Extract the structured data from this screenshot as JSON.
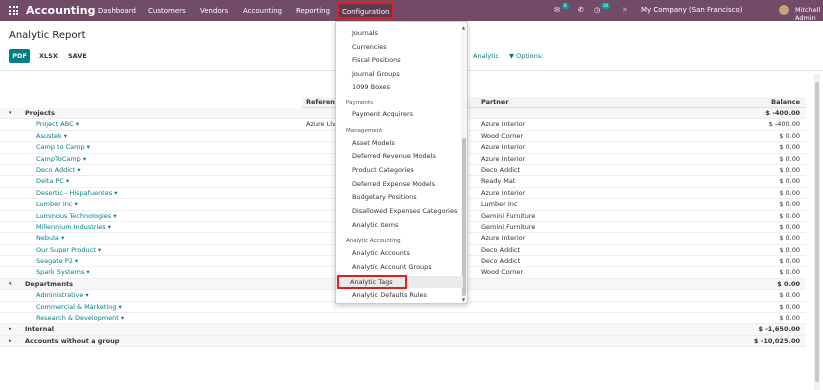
{
  "nav": {
    "brand": "Accounting",
    "items": [
      "Dashboard",
      "Customers",
      "Vendors",
      "Accounting",
      "Reporting",
      "Configuration"
    ],
    "chat_count": "8",
    "activity_count": "34",
    "company": "My Company (San Francisco)",
    "user": "Mitchell Admin"
  },
  "page": {
    "title": "Analytic Report",
    "buttons": [
      "PDF",
      "XLSX",
      "SAVE"
    ],
    "filters": {
      "analytic": "Analytic",
      "options": "Options:"
    }
  },
  "table": {
    "headers": {
      "reference": "Reference",
      "partner": "Partner",
      "balance": "Balance"
    },
    "rows": [
      {
        "name": "Projects",
        "ref": "",
        "partner": "",
        "balance": "$ -400.00",
        "group": true,
        "caret": "▾"
      },
      {
        "name": "Project ABC ▾",
        "ref": "Azure Liv",
        "partner": "Azure Interior",
        "balance": "$ -400.00"
      },
      {
        "name": "Asustek ▾",
        "ref": "",
        "partner": "Wood Corner",
        "balance": "$ 0.00"
      },
      {
        "name": "Camp to Camp ▾",
        "ref": "",
        "partner": "Azure Interior",
        "balance": "$ 0.00"
      },
      {
        "name": "CampToCamp ▾",
        "ref": "",
        "partner": "Azure Interior",
        "balance": "$ 0.00"
      },
      {
        "name": "Deco Addict ▾",
        "ref": "",
        "partner": "Deco Addict",
        "balance": "$ 0.00"
      },
      {
        "name": "Delta PC ▾",
        "ref": "",
        "partner": "Ready Mat",
        "balance": "$ 0.00"
      },
      {
        "name": "Desertic - Hispafuentes ▾",
        "ref": "",
        "partner": "Azure Interior",
        "balance": "$ 0.00"
      },
      {
        "name": "Lumber Inc ▾",
        "ref": "",
        "partner": "Lumber Inc",
        "balance": "$ 0.00"
      },
      {
        "name": "Luminous Technologies ▾",
        "ref": "",
        "partner": "Gemini Furniture",
        "balance": "$ 0.00"
      },
      {
        "name": "Millennium Industries ▾",
        "ref": "",
        "partner": "Gemini Furniture",
        "balance": "$ 0.00"
      },
      {
        "name": "Nebula ▾",
        "ref": "",
        "partner": "Azure Interior",
        "balance": "$ 0.00"
      },
      {
        "name": "Our Super Product ▾",
        "ref": "",
        "partner": "Deco Addict",
        "balance": "$ 0.00"
      },
      {
        "name": "Seagate P2 ▾",
        "ref": "",
        "partner": "Deco Addict",
        "balance": "$ 0.00"
      },
      {
        "name": "Spark Systems ▾",
        "ref": "",
        "partner": "Wood Corner",
        "balance": "$ 0.00"
      },
      {
        "name": "Departments",
        "ref": "",
        "partner": "",
        "balance": "$ 0.00",
        "group": true,
        "caret": "▾"
      },
      {
        "name": "Administrative ▾",
        "ref": "",
        "partner": "",
        "balance": "$ 0.00"
      },
      {
        "name": "Commercial & Marketing ▾",
        "ref": "",
        "partner": "",
        "balance": "$ 0.00"
      },
      {
        "name": "Research & Development ▾",
        "ref": "",
        "partner": "",
        "balance": "$ 0.00"
      },
      {
        "name": "Internal",
        "ref": "",
        "partner": "",
        "balance": "$ -1,650.00",
        "group": true,
        "caret": "▸"
      },
      {
        "name": "Accounts without a group",
        "ref": "",
        "partner": "",
        "balance": "$ -10,025.00",
        "group": true,
        "caret": "▸"
      }
    ]
  },
  "dropdown": {
    "items": [
      {
        "type": "item",
        "label": "Journals"
      },
      {
        "type": "item",
        "label": "Currencies"
      },
      {
        "type": "item",
        "label": "Fiscal Positions"
      },
      {
        "type": "item",
        "label": "Journal Groups"
      },
      {
        "type": "item",
        "label": "1099 Boxes"
      },
      {
        "type": "header",
        "label": "Payments"
      },
      {
        "type": "item",
        "label": "Payment Acquirers"
      },
      {
        "type": "header",
        "label": "Management"
      },
      {
        "type": "item",
        "label": "Asset Models"
      },
      {
        "type": "item",
        "label": "Deferred Revenue Models"
      },
      {
        "type": "item",
        "label": "Product Categories"
      },
      {
        "type": "item",
        "label": "Deferred Expense Models"
      },
      {
        "type": "item",
        "label": "Budgetary Positions"
      },
      {
        "type": "item",
        "label": "Disallowed Expenses Categories"
      },
      {
        "type": "item",
        "label": "Analytic Items"
      },
      {
        "type": "header",
        "label": "Analytic Accounting"
      },
      {
        "type": "item",
        "label": "Analytic Accounts"
      },
      {
        "type": "item",
        "label": "Analytic Account Groups"
      },
      {
        "type": "item",
        "label": "Analytic Tags"
      },
      {
        "type": "item",
        "label": "Analytic Defaults Rules"
      }
    ]
  }
}
